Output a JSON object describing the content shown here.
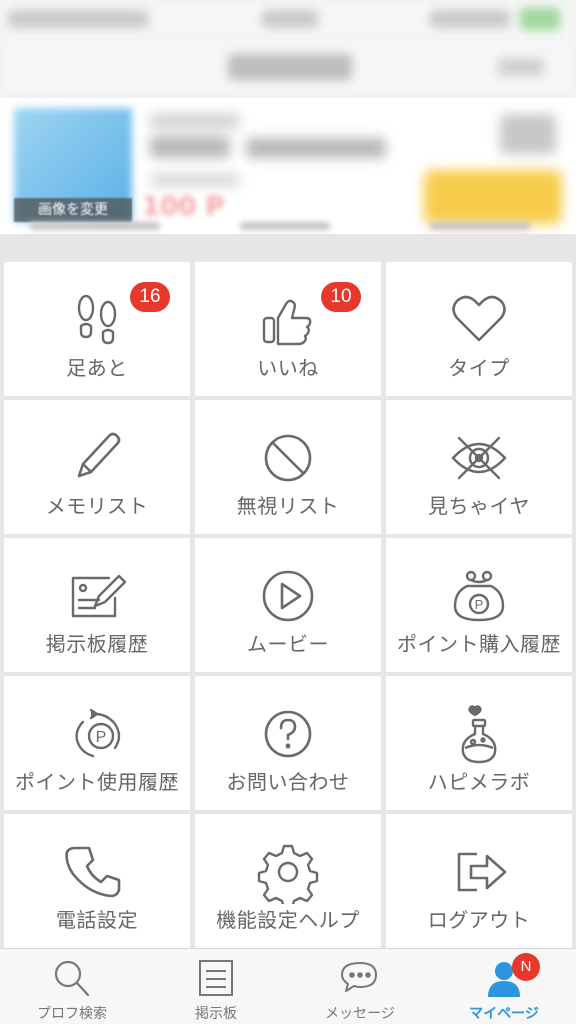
{
  "profile": {
    "photo_change_label": "画像を変更",
    "points": "100 P"
  },
  "menu": {
    "items": [
      {
        "label": "足あと",
        "icon": "footprints-icon",
        "badge": "16"
      },
      {
        "label": "いいね",
        "icon": "thumbs-up-icon",
        "badge": "10"
      },
      {
        "label": "タイプ",
        "icon": "heart-icon"
      },
      {
        "label": "メモリスト",
        "icon": "pencil-icon"
      },
      {
        "label": "無視リスト",
        "icon": "prohibited-icon"
      },
      {
        "label": "見ちゃイヤ",
        "icon": "eye-crossed-icon"
      },
      {
        "label": "掲示板履歴",
        "icon": "board-edit-icon"
      },
      {
        "label": "ムービー",
        "icon": "play-icon"
      },
      {
        "label": "ポイント購入履歴",
        "icon": "coin-purse-icon"
      },
      {
        "label": "ポイント使用履歴",
        "icon": "point-cycle-icon"
      },
      {
        "label": "お問い合わせ",
        "icon": "question-icon"
      },
      {
        "label": "ハピメラボ",
        "icon": "flask-icon"
      },
      {
        "label": "電話設定",
        "icon": "phone-icon"
      },
      {
        "label": "機能設定ヘルプ",
        "icon": "gear-icon"
      },
      {
        "label": "ログアウト",
        "icon": "logout-icon"
      }
    ]
  },
  "tabs": [
    {
      "label": "プロフ検索",
      "icon": "search-icon"
    },
    {
      "label": "掲示板",
      "icon": "board-icon"
    },
    {
      "label": "メッセージ",
      "icon": "chat-bubble-icon"
    },
    {
      "label": "マイページ",
      "icon": "person-icon",
      "badge": "N",
      "active": true
    }
  ],
  "colors": {
    "accent": "#2d94e0",
    "badge": "#e8372b",
    "icon_gray": "#6a6a6a",
    "login_button": "#f7cc4a"
  }
}
